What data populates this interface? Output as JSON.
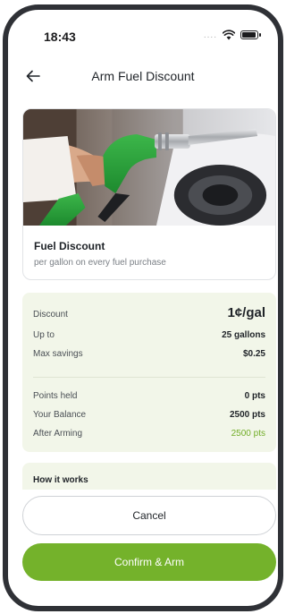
{
  "status_bar": {
    "time": "18:43",
    "signal_dots": "....",
    "icons": [
      "wifi-icon",
      "battery-icon"
    ]
  },
  "header": {
    "back_icon": "arrow-left-icon",
    "title": "Arm Fuel Discount"
  },
  "offer": {
    "image": "fuel-pump-nozzle-photo",
    "title": "Fuel Discount",
    "subtitle": "per gallon on every fuel purchase"
  },
  "details": {
    "discount": {
      "label": "Discount",
      "value": "1¢/gal"
    },
    "up_to": {
      "label": "Up to",
      "value": "25 gallons"
    },
    "max_savings": {
      "label": "Max savings",
      "value": "$0.25"
    },
    "points_held": {
      "label": "Points held",
      "value": "0 pts"
    },
    "your_balance": {
      "label": "Your Balance",
      "value": "2500 pts"
    },
    "after_arming": {
      "label": "After Arming",
      "value": "2500 pts"
    }
  },
  "how_it_works": {
    "label": "How it works"
  },
  "actions": {
    "cancel_label": "Cancel",
    "confirm_label": "Confirm & Arm"
  },
  "colors": {
    "accent_green": "#74b22b",
    "panel_bg": "#f2f6e9",
    "highlight_text": "#72ad28"
  }
}
